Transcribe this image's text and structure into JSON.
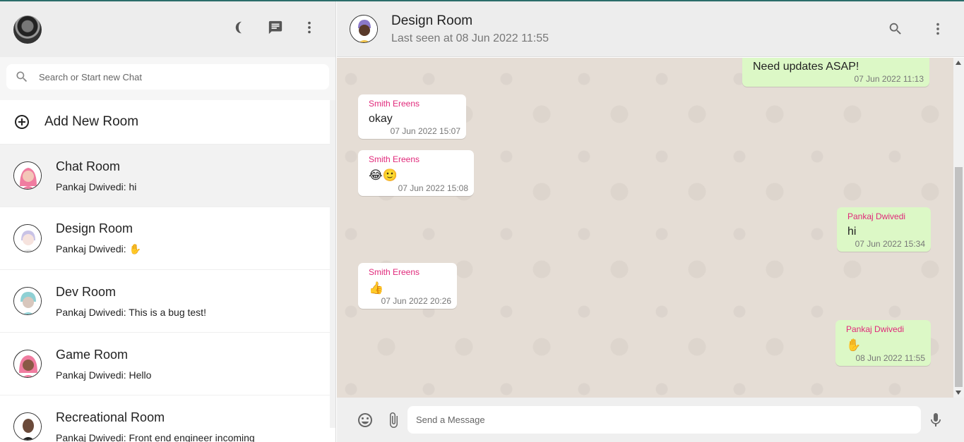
{
  "sidebar": {
    "search_placeholder": "Search or Start new Chat",
    "add_room_label": "Add New Room",
    "rooms": [
      {
        "name": "Chat Room",
        "last": "Pankaj Dwivedi: hi",
        "active": true
      },
      {
        "name": "Design Room",
        "last": "Pankaj Dwivedi: ✋",
        "active": false
      },
      {
        "name": "Dev Room",
        "last": "Pankaj Dwivedi: This is a bug test!",
        "active": false
      },
      {
        "name": "Game Room",
        "last": "Pankaj Dwivedi: Hello",
        "active": false
      },
      {
        "name": "Recreational Room",
        "last": "Pankaj Dwivedi: Front end engineer incoming",
        "active": false
      }
    ]
  },
  "chat": {
    "title": "Design Room",
    "subtitle": "Last seen at 08 Jun 2022 11:55",
    "messages": [
      {
        "author": "",
        "text": "Need updates ASAP!",
        "time": "07 Jun 2022 11:13",
        "mine": true
      },
      {
        "author": "Smith Ereens",
        "text": "okay",
        "time": "07 Jun 2022 15:07",
        "mine": false
      },
      {
        "author": "Smith Ereens",
        "text": "😂🙂",
        "time": "07 Jun 2022 15:08",
        "mine": false
      },
      {
        "author": "Pankaj Dwivedi",
        "text": "hi",
        "time": "07 Jun 2022 15:34",
        "mine": true
      },
      {
        "author": "Smith Ereens",
        "text": "👍",
        "time": "07 Jun 2022 20:26",
        "mine": false
      },
      {
        "author": "Pankaj Dwivedi",
        "text": "✋",
        "time": "08 Jun 2022 11:55",
        "mine": true
      }
    ],
    "composer_placeholder": "Send a Message"
  },
  "colors": {
    "accent_author": "#e0287a",
    "outgoing_bubble": "#dcf8c6",
    "header_bg": "#ededed"
  }
}
